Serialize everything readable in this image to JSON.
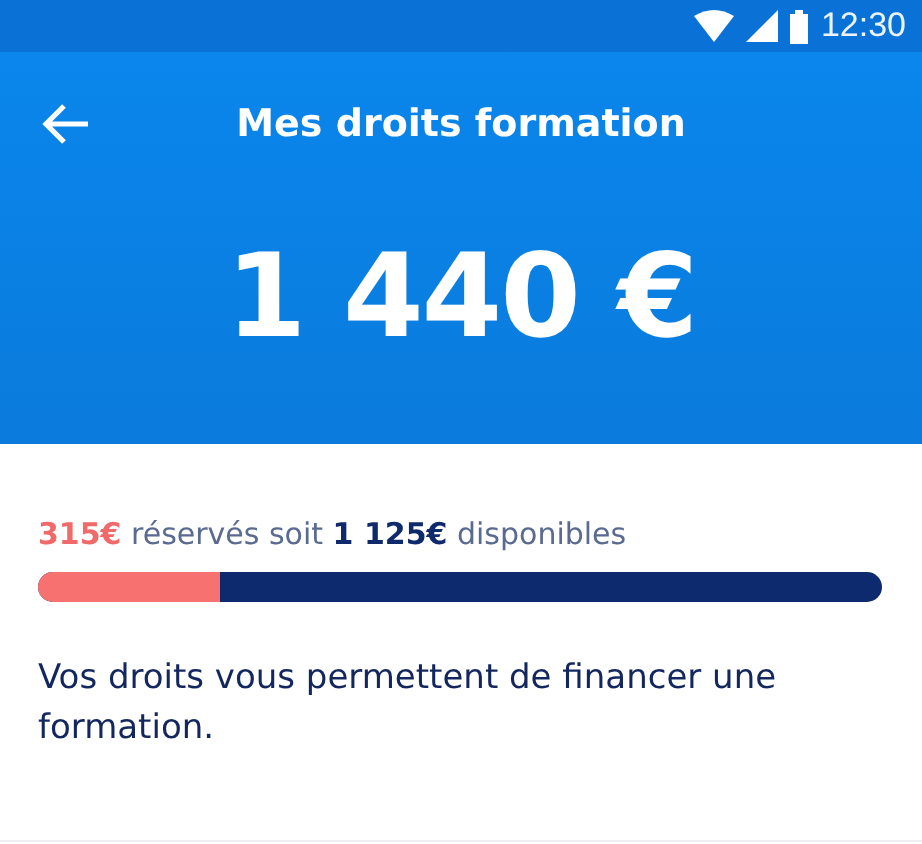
{
  "status_bar": {
    "time": "12:30"
  },
  "header": {
    "title": "Mes droits formation",
    "amount": "1 440 €"
  },
  "summary": {
    "text": "**315€** réservés soit **1 125€** disponibles",
    "level": 0.215
  },
  "description": "Vos droits vous permettent de financer une formation."
}
